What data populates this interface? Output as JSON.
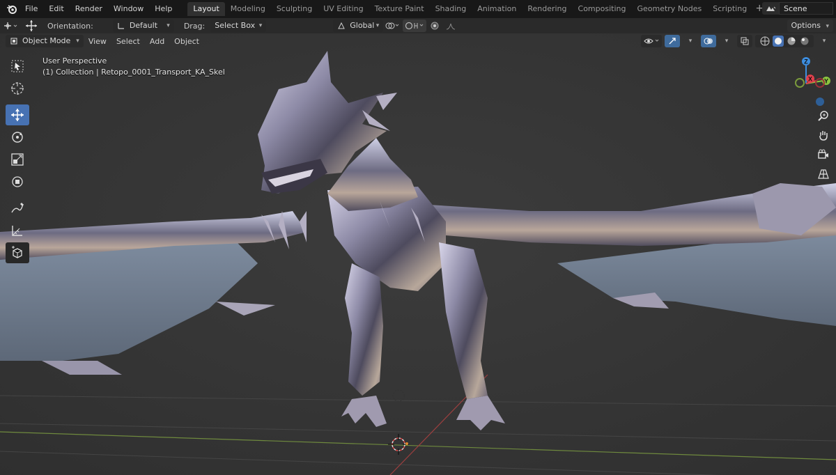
{
  "menu": {
    "logo": "blender-logo-icon",
    "items": [
      "File",
      "Edit",
      "Render",
      "Window",
      "Help"
    ]
  },
  "workspaces": {
    "tabs": [
      "Layout",
      "Modeling",
      "Sculpting",
      "UV Editing",
      "Texture Paint",
      "Shading",
      "Animation",
      "Rendering",
      "Compositing",
      "Geometry Nodes",
      "Scripting"
    ],
    "active": "Layout",
    "add_icon": "+"
  },
  "scene": {
    "name": "Scene"
  },
  "tool_settings": {
    "orientation_label": "Orientation:",
    "orientation_value": "Default",
    "drag_label": "Drag:",
    "drag_value": "Select Box",
    "transform_orientation": "Global",
    "options_label": "Options"
  },
  "viewport_header": {
    "mode": "Object Mode",
    "menus": [
      "View",
      "Select",
      "Add",
      "Object"
    ]
  },
  "viewport_info": {
    "view_name": "User Perspective",
    "collection_line": "(1) Collection | Retopo_0001_Transport_KA_Skel"
  },
  "gizmo": {
    "z": "Z",
    "y": "Y",
    "x": "X"
  },
  "colors": {
    "accent": "#4772b3",
    "axis_x": "#e2404c",
    "axis_y": "#8bc53f",
    "axis_z": "#3d8ee0",
    "viewport_bg": "#3b3b3b"
  }
}
